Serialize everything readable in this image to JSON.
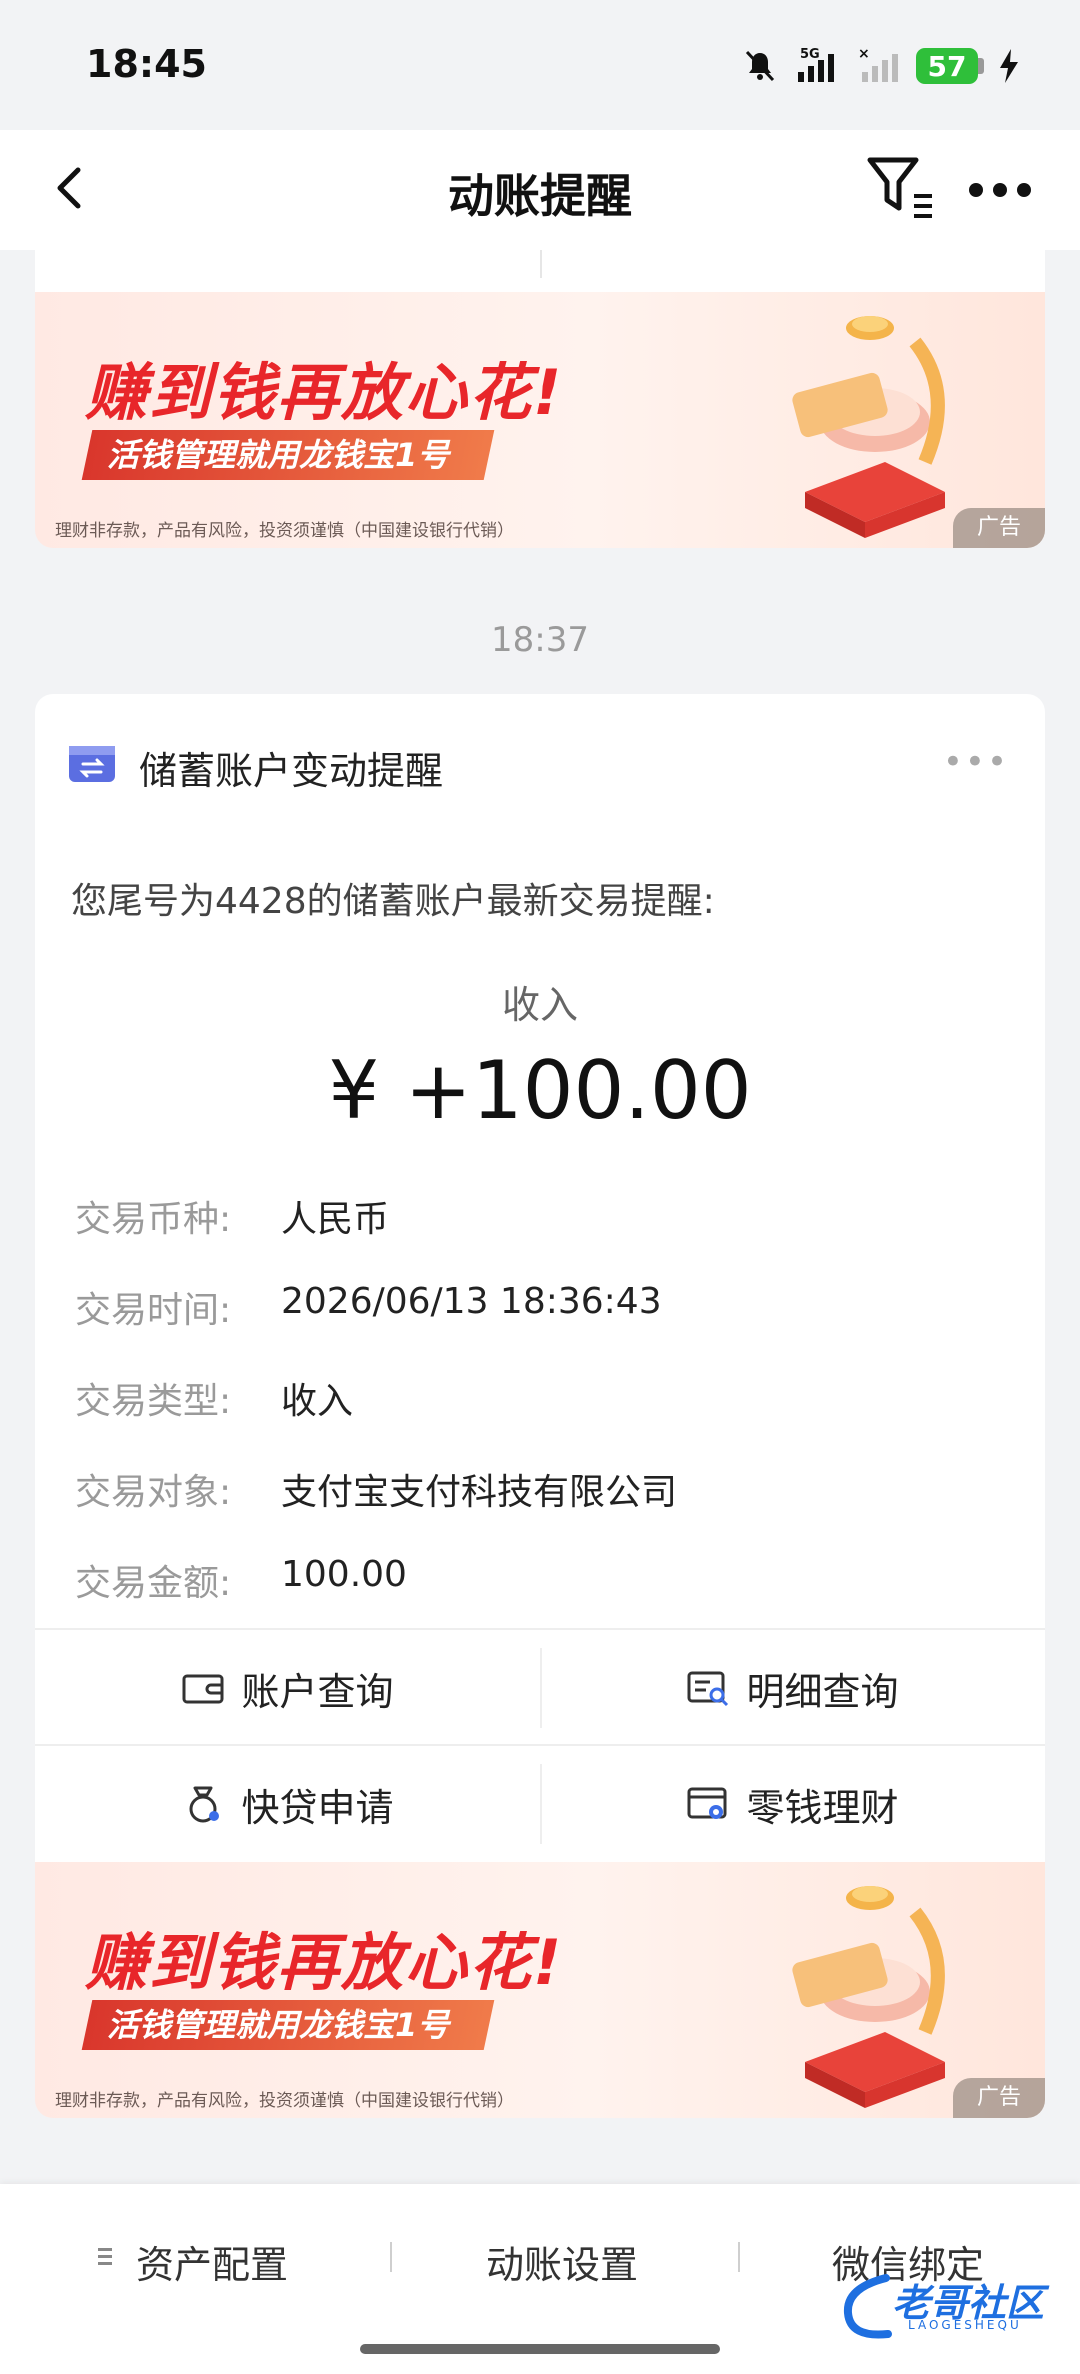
{
  "status_bar": {
    "time": "18:45",
    "network": "5G",
    "battery": "57"
  },
  "nav": {
    "title": "动账提醒"
  },
  "ad": {
    "headline": "赚到钱再放心花!",
    "sub": "活钱管理就用龙钱宝1号",
    "disclaimer": "理财非存款，产品有风险，投资须谨慎（中国建设银行代销）",
    "tag": "广告"
  },
  "timestamp": "18:37",
  "card": {
    "title": "储蓄账户变动提醒",
    "more": "•••",
    "intro": "您尾号为4428的储蓄账户最新交易提醒:",
    "tx_type_label": "收入",
    "amount": "¥ +100.00",
    "details": [
      {
        "key": "交易币种:",
        "value": "人民币"
      },
      {
        "key": "交易时间:",
        "value": "2026/06/13 18:36:43"
      },
      {
        "key": "交易类型:",
        "value": "收入"
      },
      {
        "key": "交易对象:",
        "value": "支付宝支付科技有限公司"
      },
      {
        "key": "交易金额:",
        "value": "100.00"
      }
    ],
    "actions": [
      {
        "label": "账户查询",
        "icon": "wallet-icon"
      },
      {
        "label": "明细查询",
        "icon": "detail-search-icon"
      },
      {
        "label": "快贷申请",
        "icon": "loan-bag-icon"
      },
      {
        "label": "零钱理财",
        "icon": "wealth-card-icon"
      }
    ]
  },
  "bottom_bar": {
    "items": [
      "资产配置",
      "动账设置",
      "微信绑定"
    ]
  },
  "watermark": {
    "text": "老哥社区",
    "sub": "LAOGESHEQU"
  },
  "colors": {
    "ad_red": "#e8262a",
    "battery_green": "#2fbf3a",
    "watermark_blue": "#1e6fe0"
  }
}
